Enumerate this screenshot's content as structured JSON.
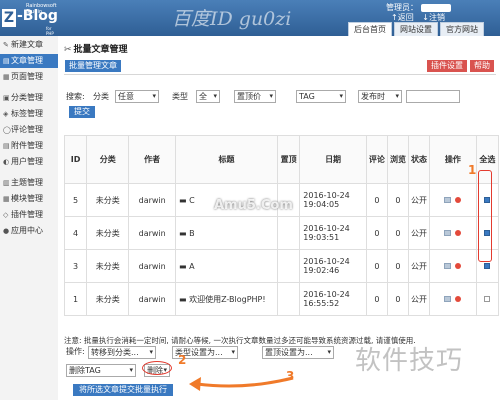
{
  "header": {
    "studio": "Rainbowsoft Studio",
    "logo_box": "Z",
    "logo_name": "-Blog",
    "for_php": "for PHP",
    "watermark": "百度ID gu0zi",
    "admin_label": "管理员：",
    "link_back": "↑返回",
    "link_logout": "↓注销",
    "tabs": [
      "后台首页",
      "网站设置",
      "官方网站"
    ]
  },
  "sidebar": {
    "items": [
      {
        "icon": "✎",
        "label": "新建文章",
        "active": false
      },
      {
        "icon": "▤",
        "label": "文章管理",
        "active": true
      },
      {
        "icon": "▦",
        "label": "页面管理",
        "active": false
      },
      {
        "icon": "▣",
        "label": "分类管理",
        "active": false
      },
      {
        "icon": "◈",
        "label": "标签管理",
        "active": false
      },
      {
        "icon": "◯",
        "label": "评论管理",
        "active": false
      },
      {
        "icon": "▤",
        "label": "附件管理",
        "active": false
      },
      {
        "icon": "◐",
        "label": "用户管理",
        "active": false
      },
      {
        "icon": "▥",
        "label": "主题管理",
        "active": false
      },
      {
        "icon": "▦",
        "label": "模块管理",
        "active": false
      },
      {
        "icon": "◇",
        "label": "插件管理",
        "active": false
      },
      {
        "icon": "●",
        "label": "应用中心",
        "active": false
      }
    ]
  },
  "main": {
    "title": "批量文章管理",
    "pill": "批量管理文章",
    "plugin_settings": "插件设置",
    "help": "帮助",
    "filter": {
      "search_label": "搜索:",
      "category_label": "分类",
      "category_value": "任意",
      "type_label": "类型",
      "type_value": "全",
      "sticky_value": "置顶价",
      "tag_value": "TAG",
      "publisher_value": "发布时",
      "submit": "提交"
    },
    "columns": [
      "ID",
      "分类",
      "作者",
      "标题",
      "置顶",
      "日期",
      "评论",
      "浏览",
      "状态",
      "操作",
      "全选"
    ],
    "rows": [
      {
        "id": "5",
        "category": "未分类",
        "author": "darwin",
        "title": "C",
        "sticky": "",
        "date": "2016-10-24 19:04:05",
        "comments": "0",
        "views": "0",
        "status": "公开",
        "checked": true
      },
      {
        "id": "4",
        "category": "未分类",
        "author": "darwin",
        "title": "B",
        "sticky": "",
        "date": "2016-10-24 19:03:51",
        "comments": "0",
        "views": "0",
        "status": "公开",
        "checked": true
      },
      {
        "id": "3",
        "category": "未分类",
        "author": "darwin",
        "title": "A",
        "sticky": "",
        "date": "2016-10-24 19:02:46",
        "comments": "0",
        "views": "0",
        "status": "公开",
        "checked": true
      },
      {
        "id": "1",
        "category": "未分类",
        "author": "darwin",
        "title": "欢迎使用Z-BlogPHP!",
        "sticky": "",
        "date": "2016-10-24 16:55:52",
        "comments": "0",
        "views": "0",
        "status": "公开",
        "checked": false
      }
    ],
    "note": "注意: 批量执行会消耗一定时间, 请耐心等候, 一次执行文章数量过多还可能导致系统资源过载, 请谨慎使用.",
    "ops_label": "操作:",
    "move_category": "转移到分类...",
    "type_set": "类型设置为...",
    "sticky_set": "置顶设置为...",
    "delete_tag": "删除TAG",
    "delete": "删除",
    "execute": "将所选文章提交批量执行"
  },
  "annotations": {
    "step1": "1",
    "step2": "2",
    "step3": "3",
    "site_watermark": "Amu5.Com",
    "corner_watermark": "软件技巧"
  }
}
